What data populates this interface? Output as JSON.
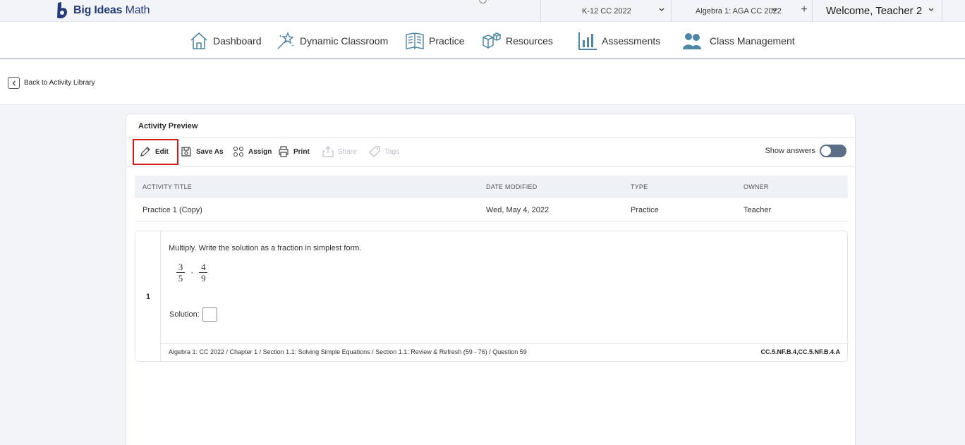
{
  "brand": {
    "bold": "Big Ideas",
    "light": "Math",
    "color": "#243b7a"
  },
  "topbar": {
    "program_select": "K-12 CC 2022",
    "course_select": "Algebra 1: AGA CC 2022",
    "add_symbol": "+",
    "welcome": "Welcome, Teacher 2"
  },
  "nav": {
    "items": [
      {
        "label": "Dashboard",
        "icon": "home-icon"
      },
      {
        "label": "Dynamic Classroom",
        "icon": "wand-icon"
      },
      {
        "label": "Practice",
        "icon": "book-icon"
      },
      {
        "label": "Resources",
        "icon": "cubes-icon"
      },
      {
        "label": "Assessments",
        "icon": "bar-chart-icon"
      },
      {
        "label": "Class Management",
        "icon": "people-icon"
      }
    ]
  },
  "back": {
    "label": "Back to Activity Library"
  },
  "panel": {
    "title": "Activity Preview",
    "toolbar": {
      "edit": "Edit",
      "save_as": "Save As",
      "assign": "Assign",
      "print": "Print",
      "share": "Share",
      "tags": "Tags",
      "show_answers": "Show answers",
      "show_answers_on": false
    },
    "table": {
      "headers": [
        "ACTIVITY TITLE",
        "DATE MODIFIED",
        "TYPE",
        "OWNER"
      ],
      "row": [
        "Practice 1 (Copy)",
        "Wed, May 4, 2022",
        "Practice",
        "Teacher"
      ]
    },
    "question": {
      "number": "1",
      "prompt": "Multiply. Write the solution as a fraction in simplest form.",
      "frac1_num": "3",
      "frac1_den": "5",
      "operator": "·",
      "frac2_num": "4",
      "frac2_den": "9",
      "solution_label": "Solution:",
      "breadcrumb": "Algebra 1: CC 2022 / Chapter 1 / Section 1.1: Solving Simple Equations / Section 1.1: Review & Refresh (59 - 76) / Question 59",
      "standards": "CC.5.NF.B.4,CC.5.NF.B.4.A"
    }
  },
  "colors": {
    "highlight": "#d21b1b",
    "nav_icon": "#4f88a6",
    "toggle": "#5a6e87"
  }
}
